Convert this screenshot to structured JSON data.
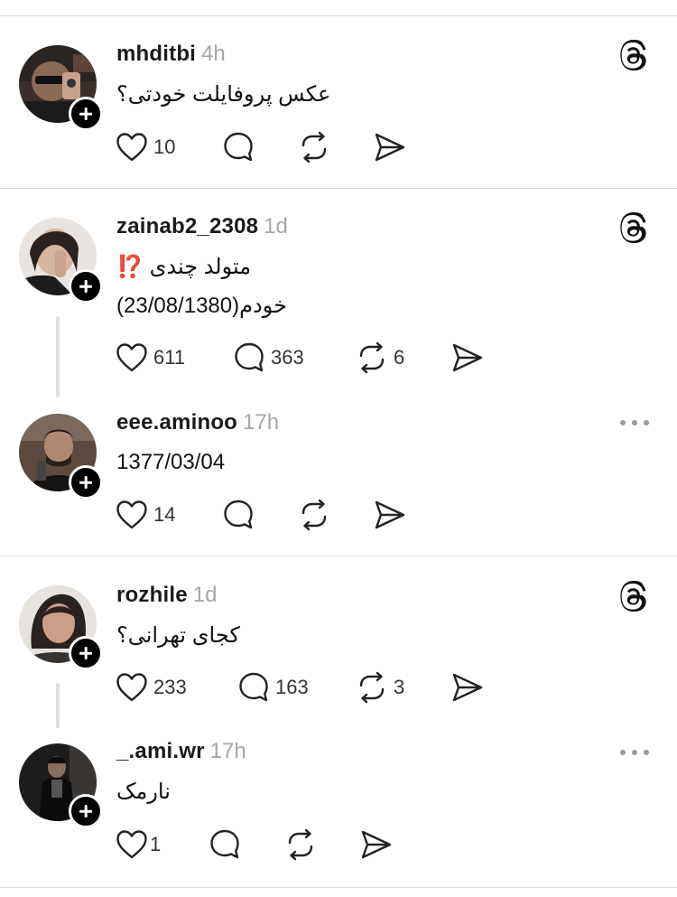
{
  "posts": [
    {
      "username": "mhditbi",
      "time": "4h",
      "text": "عکس پروفایلت خودتی؟",
      "likes": "10",
      "replies": "",
      "reposts": "",
      "corner_icon": "threads-logo-icon"
    },
    {
      "username": "zainab2_2308",
      "time": "1d",
      "text_line1": "متولد چندی",
      "emoji": "⁉️",
      "text_line2": "خودم(23/08/1380)",
      "likes": "611",
      "replies": "363",
      "reposts": "6",
      "corner_icon": "threads-logo-icon"
    },
    {
      "username": "eee.aminoo",
      "time": "17h",
      "text": "1377/03/04",
      "likes": "14",
      "replies": "",
      "reposts": "",
      "corner_icon": "more-options-icon"
    },
    {
      "username": "rozhile",
      "time": "1d",
      "text": "کجای تهرانی؟",
      "likes": "233",
      "replies": "163",
      "reposts": "3",
      "corner_icon": "threads-logo-icon"
    },
    {
      "username": "_.ami.wr",
      "time": "17h",
      "text": "نارمک",
      "likes": "1",
      "replies": "",
      "reposts": "",
      "corner_icon": "more-options-icon"
    }
  ],
  "icons": {
    "like": "heart-icon",
    "reply": "comment-icon",
    "repost": "repost-icon",
    "share": "send-icon",
    "follow": "plus-icon"
  },
  "colors": {
    "text": "#1a1a1a",
    "muted": "#a6a6a6",
    "separator": "#dcdcdc",
    "emoji_red": "#e0493a"
  }
}
